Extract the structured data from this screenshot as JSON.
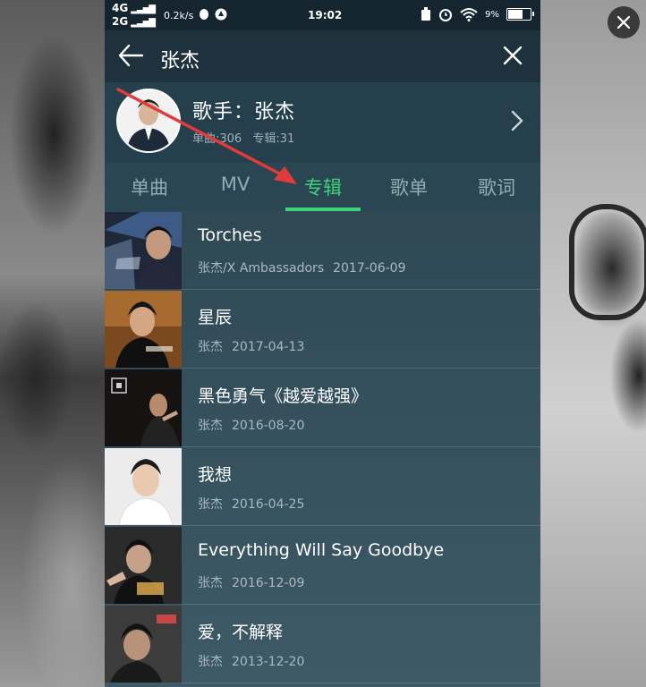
{
  "status_bar": {
    "network_top": "4G",
    "network_bottom": "2G",
    "speed": "0.2k/s",
    "time": "19:02",
    "battery_pct": "9%",
    "battery_level": 0.62
  },
  "header": {
    "search_query": "张杰"
  },
  "artist": {
    "name": "歌手：张杰",
    "singles": "单曲:306",
    "albums": "专辑:31"
  },
  "tabs": [
    {
      "label": "单曲",
      "active": false
    },
    {
      "label": "MV",
      "active": false
    },
    {
      "label": "专辑",
      "active": true
    },
    {
      "label": "歌单",
      "active": false
    },
    {
      "label": "歌词",
      "active": false
    }
  ],
  "albums": [
    {
      "title": "Torches",
      "artists": "张杰/X Ambassadors",
      "date": "2017-06-09",
      "cover_color": "#2c3e5a"
    },
    {
      "title": "星辰",
      "artists": "张杰",
      "date": "2017-04-13",
      "cover_color": "#8a5a2a"
    },
    {
      "title": "黑色勇气《越爱越强》",
      "artists": "张杰",
      "date": "2016-08-20",
      "cover_color": "#1a1616"
    },
    {
      "title": "我想",
      "artists": "张杰",
      "date": "2016-04-25",
      "cover_color": "#e8e8e8"
    },
    {
      "title": "Everything Will Say Goodbye",
      "artists": "张杰",
      "date": "2016-12-09",
      "cover_color": "#2b2b2b"
    },
    {
      "title": "爱，不解释",
      "artists": "张杰",
      "date": "2013-12-20",
      "cover_color": "#4a4a4a"
    }
  ],
  "colors": {
    "accent": "#3fd27c",
    "annotation_arrow": "#e23b3b"
  }
}
